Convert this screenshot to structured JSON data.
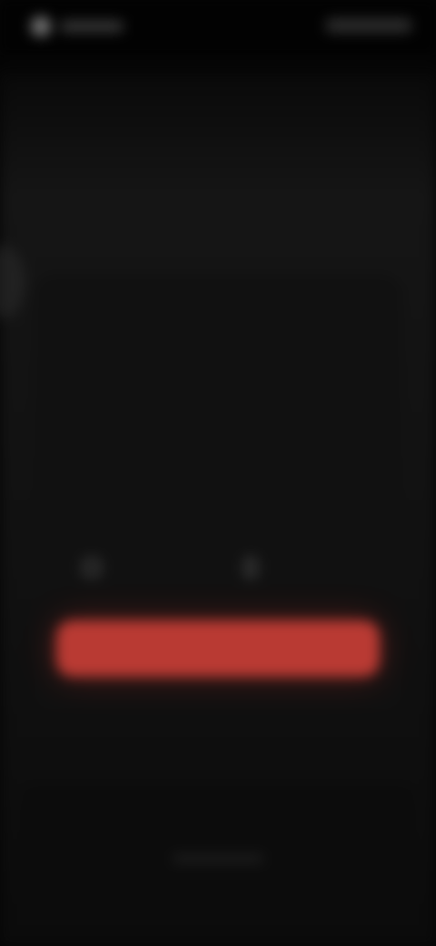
{
  "status_bar": {
    "left_text": "",
    "right_text": ""
  },
  "dialog": {
    "title": "",
    "subtitle": "",
    "option_left": "",
    "option_right": "",
    "button_label": ""
  },
  "colors": {
    "background": "#050505",
    "card": "#111111",
    "accent": "#b93a33",
    "title_text": "#e6e6e6"
  },
  "icons": {
    "status_logo": "logo-icon",
    "option_left": "checkbox-icon",
    "option_right": "phone-icon"
  }
}
